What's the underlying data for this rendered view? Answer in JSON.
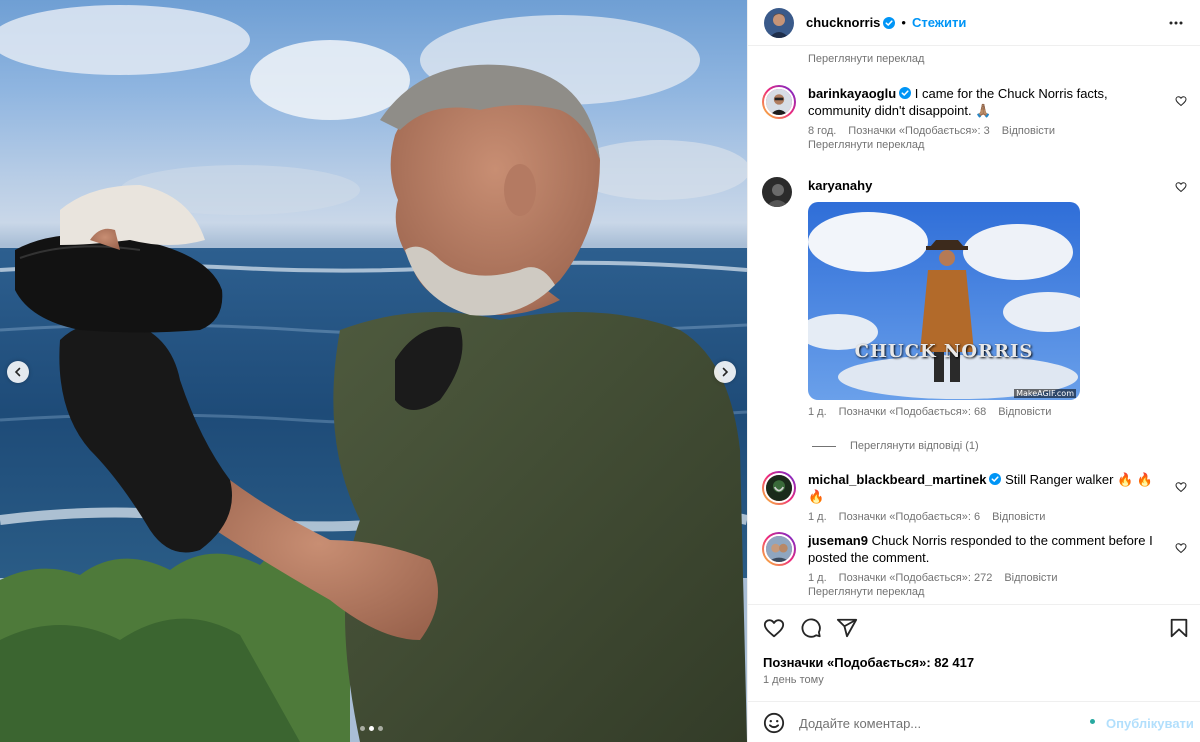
{
  "post": {
    "author": "chucknorris",
    "follow_label": "Стежити",
    "carousel": {
      "current_slide": 2,
      "total_slides": 3
    }
  },
  "top_translate": "Переглянути переклад",
  "comments": [
    {
      "username": "barinkayaoglu",
      "verified": true,
      "text": "I came for the Chuck Norris facts, community didn't disappoint. 🙏🏽",
      "time": "8 год.",
      "likes": "Позначки «Подобається»: 3",
      "reply": "Відповісти",
      "translate": "Переглянути переклад"
    },
    {
      "username": "karyanahy",
      "verified": false,
      "gif_watermark": "MakeAGIF.com",
      "gif_title": "CHUCK NORRIS",
      "time": "1 д.",
      "likes": "Позначки «Подобається»: 68",
      "reply": "Відповісти",
      "view_replies": "Переглянути відповіді (1)"
    },
    {
      "username": "michal_blackbeard_martinek",
      "verified": true,
      "text": "Still Ranger walker 🔥 🔥 🔥",
      "time": "1 д.",
      "likes": "Позначки «Подобається»: 6",
      "reply": "Відповісти"
    },
    {
      "username": "juseman9",
      "verified": false,
      "text": "Chuck Norris responded to the comment before I posted the comment.",
      "time": "1 д.",
      "likes": "Позначки «Подобається»: 272",
      "reply": "Відповісти",
      "translate": "Переглянути переклад"
    }
  ],
  "footer": {
    "likes_total": "Позначки «Подобається»: 82 417",
    "posted_ago": "1 день тому",
    "comment_placeholder": "Додайте коментар...",
    "post_button": "Опублікувати"
  },
  "icons": {
    "more": "more-horizontal-icon",
    "like": "heart-icon",
    "comment": "comment-icon",
    "share": "share-icon",
    "save": "bookmark-icon",
    "emoji": "emoji-icon",
    "verified": "verified-badge-icon"
  },
  "colors": {
    "accent": "#0095f6",
    "secondary_text": "#737373",
    "divider": "#efefef",
    "verified": "#0095f6"
  }
}
